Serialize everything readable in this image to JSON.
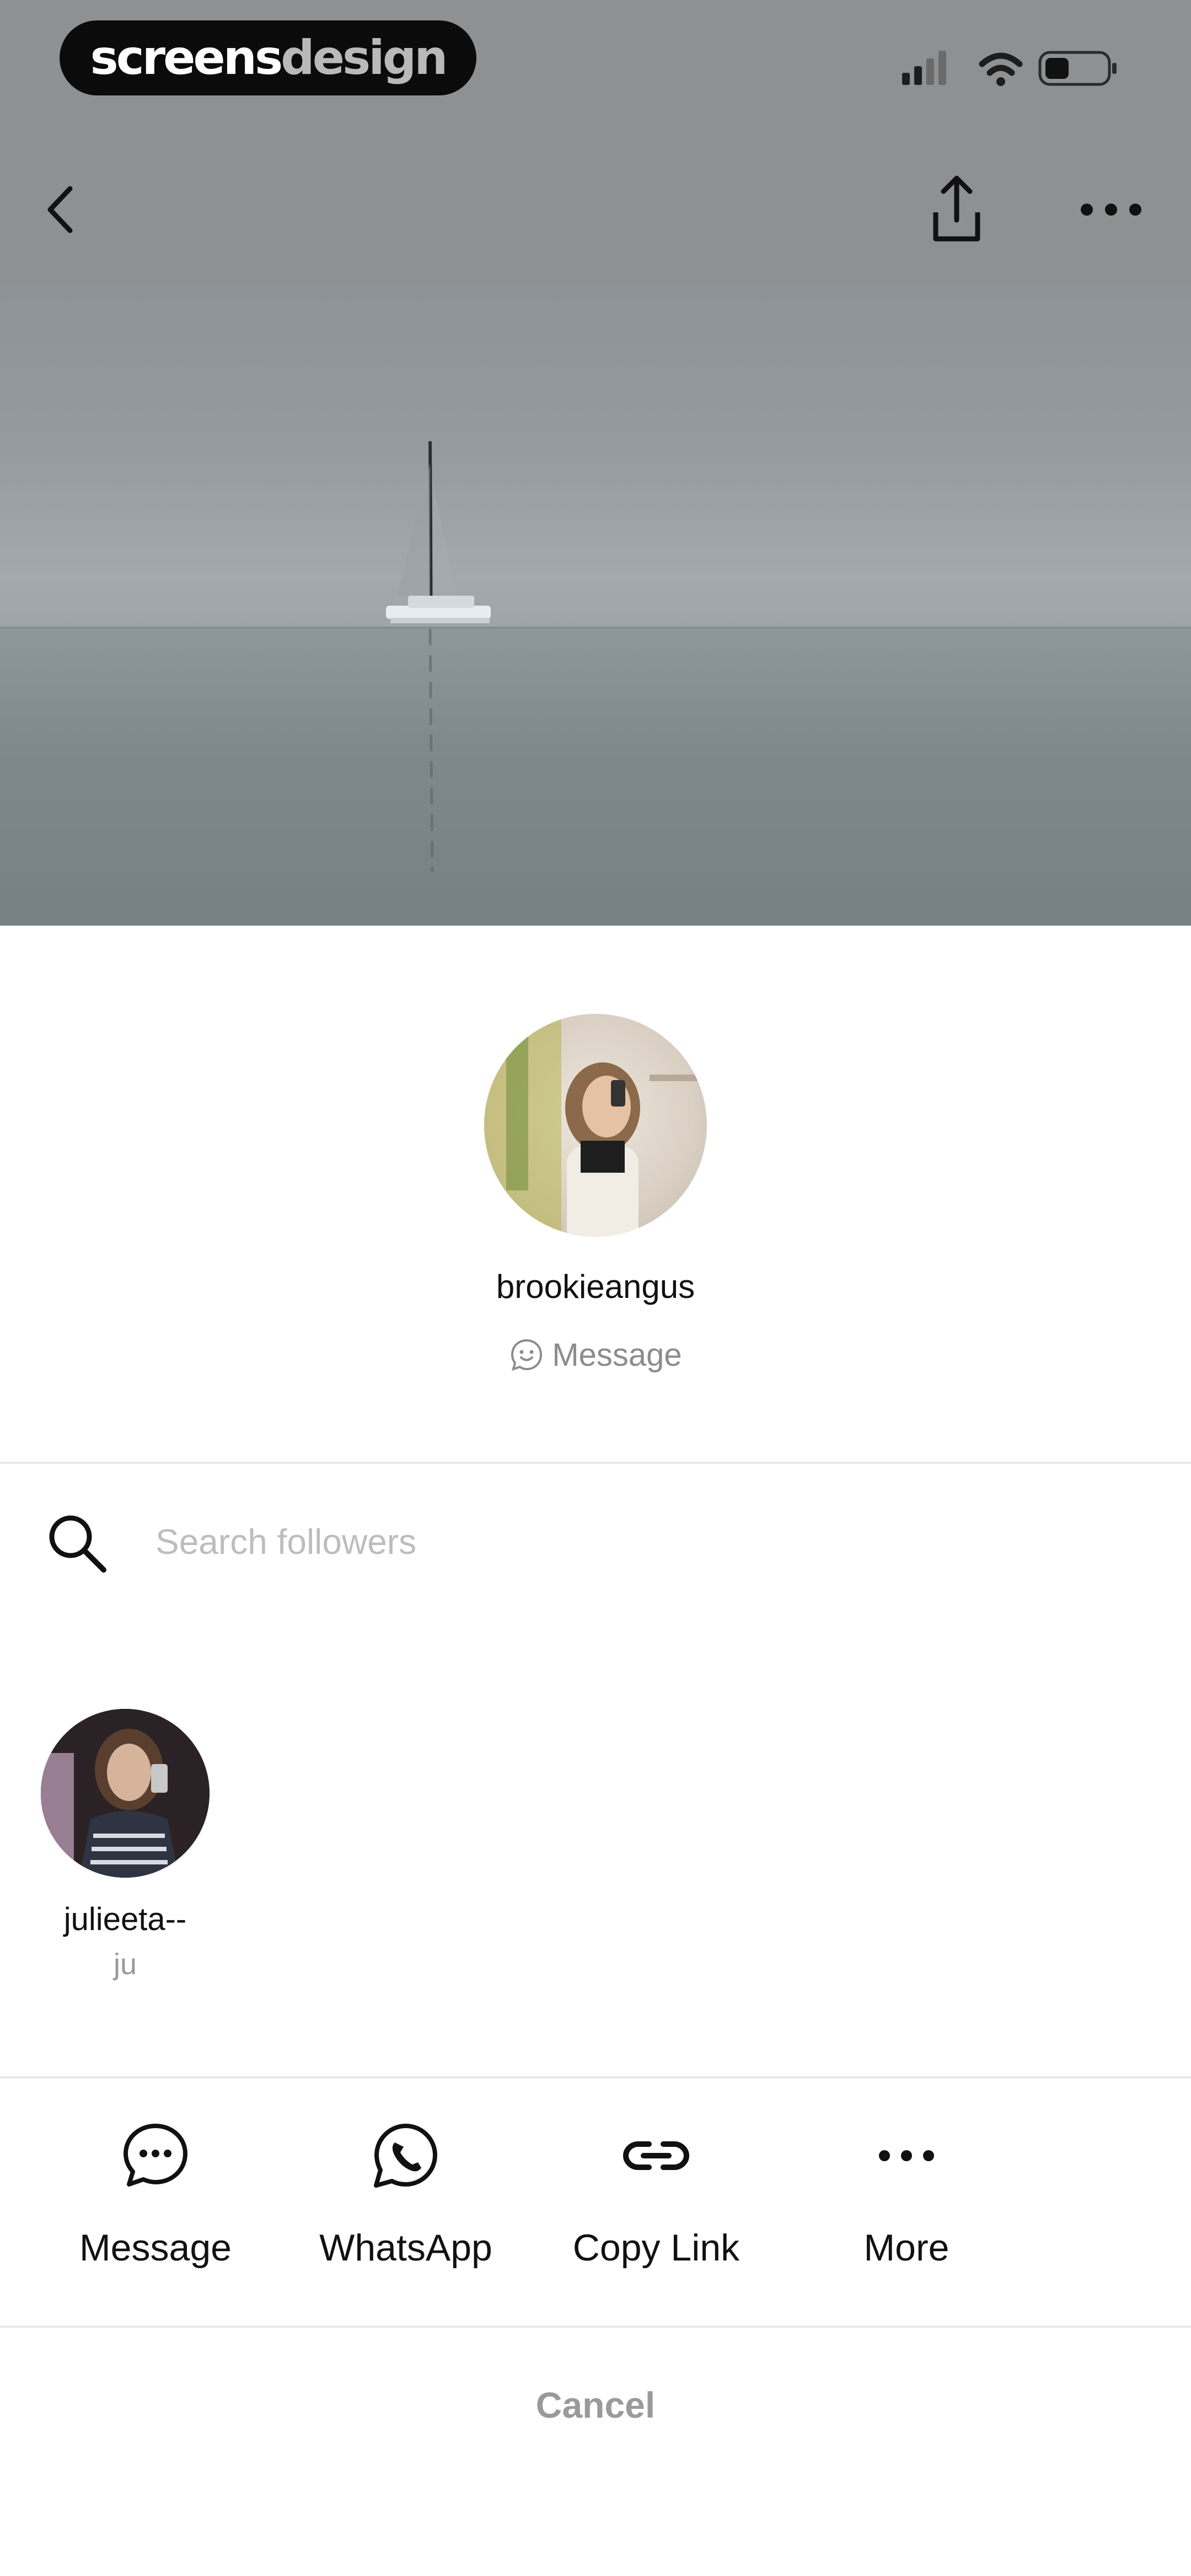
{
  "brand": {
    "part1": "screens",
    "part2": "design"
  },
  "profile": {
    "username": "brookieangus",
    "message_label": "Message"
  },
  "search": {
    "placeholder": "Search followers",
    "value": ""
  },
  "followers": [
    {
      "username": "julieeta--",
      "subtitle": "ju"
    }
  ],
  "share_actions": [
    {
      "label": "Message",
      "icon": "message-bubble-icon"
    },
    {
      "label": "WhatsApp",
      "icon": "whatsapp-icon"
    },
    {
      "label": "Copy Link",
      "icon": "link-icon"
    },
    {
      "label": "More",
      "icon": "more-dots-icon"
    }
  ],
  "cancel_label": "Cancel",
  "colors": {
    "text_primary": "#111111",
    "text_muted": "#8c8c8c",
    "placeholder": "#bdbdbd",
    "divider": "#e8e8e8"
  }
}
